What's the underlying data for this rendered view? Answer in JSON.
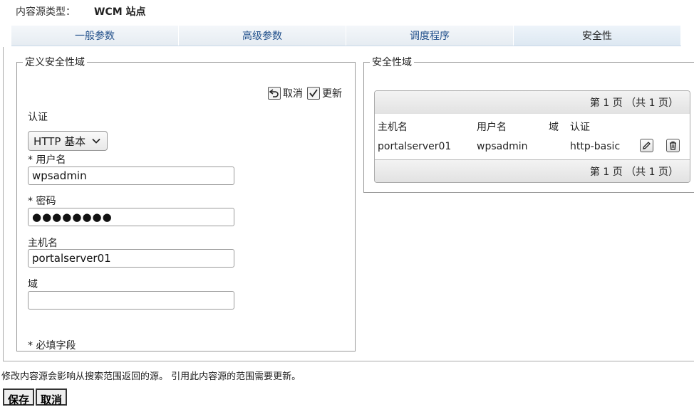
{
  "source_type": {
    "label": "内容源类型：",
    "value": "WCM 站点"
  },
  "tabs": [
    {
      "label": "一般参数"
    },
    {
      "label": "高级参数"
    },
    {
      "label": "调度程序"
    },
    {
      "label": "安全性"
    }
  ],
  "left_panel": {
    "legend": "定义安全性域",
    "cancel_label": "取消",
    "update_label": "更新",
    "auth_label": "认证",
    "auth_selected": "HTTP 基本",
    "username_label": "* 用户名",
    "username_value": "wpsadmin",
    "password_label": "* 密码",
    "password_value": "●●●●●●●●",
    "hostname_label": "主机名",
    "hostname_value": "portalserver01",
    "domain_label": "域",
    "domain_value": "",
    "required_note": "* 必填字段"
  },
  "right_panel": {
    "legend": "安全性域",
    "pager_top": "第 1 页 （共 1 页）",
    "pager_bottom": "第 1 页 （共 1 页）",
    "columns": {
      "host": "主机名",
      "user": "用户名",
      "domain": "域",
      "auth": "认证"
    },
    "rows": [
      {
        "host": "portalserver01",
        "user": "wpsadmin",
        "domain": "",
        "auth": "http-basic"
      }
    ]
  },
  "notice": "修改内容源会影响从搜索范围返回的源。 引用此内容源的范围需要更新。",
  "buttons": {
    "save": "保存",
    "cancel": "取消"
  },
  "icons": {
    "undo": "undo-icon",
    "check": "checkmark-icon",
    "chevron": "chevron-down-icon",
    "edit": "pencil-icon",
    "delete": "trash-icon"
  }
}
